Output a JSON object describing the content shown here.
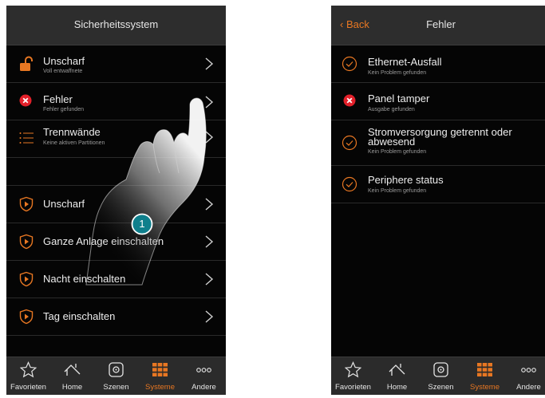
{
  "colors": {
    "accent": "#e87722",
    "error": "#e3202a",
    "background": "#050505",
    "header": "#2d2d2d"
  },
  "left_screen": {
    "title": "Sicherheitssystem",
    "rows": [
      {
        "main": "Unscharf",
        "sub": "Voll entwaffnete",
        "icon": "unlock-icon"
      },
      {
        "main": "Fehler",
        "sub": "Fehler gefunden",
        "icon": "error-icon"
      },
      {
        "main": "Trennwände",
        "sub": "Keine aktiven Partitionen",
        "icon": "list-icon"
      }
    ],
    "actions": [
      {
        "main": "Unscharf",
        "icon": "shield-play-icon"
      },
      {
        "main": "Ganze Anlage einschalten",
        "icon": "shield-play-icon"
      },
      {
        "main": "Nacht einschalten",
        "icon": "shield-play-icon"
      },
      {
        "main": "Tag einschalten",
        "icon": "shield-play-icon"
      }
    ],
    "step_badge": "1"
  },
  "right_screen": {
    "back_label": "Back",
    "title": "Fehler",
    "rows": [
      {
        "main": "Ethernet-Ausfall",
        "sub": "Kein Problem gefunden",
        "status": "ok"
      },
      {
        "main": "Panel tamper",
        "sub": "Ausgabe gefunden",
        "status": "error"
      },
      {
        "main": "Stromversorgung getrennt oder",
        "main2": "abwesend",
        "sub": "Kein Problem gefunden",
        "status": "ok"
      },
      {
        "main": "Periphere status",
        "sub": "Kein Problem gefunden",
        "status": "ok"
      }
    ]
  },
  "tabbar": {
    "tabs": [
      {
        "label": "Favorieten",
        "icon": "star-icon"
      },
      {
        "label": "Home",
        "icon": "house-icon"
      },
      {
        "label": "Szenen",
        "icon": "scene-icon"
      },
      {
        "label": "Systeme",
        "icon": "grid-icon",
        "active": true
      },
      {
        "label": "Andere",
        "icon": "more-icon"
      }
    ]
  }
}
